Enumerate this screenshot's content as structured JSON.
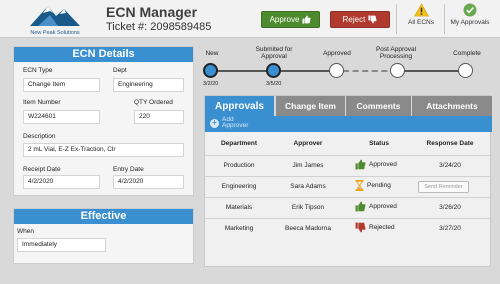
{
  "header": {
    "logo_text": "New Peak Solutions",
    "app_title": "ECN Manager",
    "ticket": "Ticket #: 2098589485",
    "approve_label": "Approve",
    "reject_label": "Reject",
    "nav_all": "All ECNs",
    "nav_my": "My Approvals"
  },
  "details": {
    "title": "ECN Details",
    "ecn_type_label": "ECN Type",
    "ecn_type_value": "Change Item",
    "dept_label": "Dept",
    "dept_value": "Engineering",
    "item_number_label": "Item Number",
    "item_number_value": "W224601",
    "qty_label": "QTY Ordered",
    "qty_value": "220",
    "description_label": "Description",
    "description_value": "2 mL Vial, E-Z Ex-Traction, Clr",
    "receipt_date_label": "Receipt Date",
    "receipt_date_value": "4/2/2020",
    "entry_date_label": "Entry Date",
    "entry_date_value": "4/2/2020"
  },
  "effective": {
    "title": "Effective",
    "when_label": "When",
    "when_value": "Immediately"
  },
  "progress": {
    "stages": [
      "New",
      "Submited for Approval",
      "Approved",
      "Post Approval Processing",
      "Complete"
    ],
    "dates": [
      "3/2/20",
      "3/5/20"
    ]
  },
  "tabs": [
    "Approvals",
    "Change Item",
    "Comments",
    "Attachments"
  ],
  "toolbar": {
    "add_approver": "Add Approver"
  },
  "table": {
    "headers": [
      "Department",
      "Approver",
      "Status",
      "Response Date"
    ],
    "rows": [
      {
        "department": "Production",
        "approver": "Jim James",
        "status": "Approved",
        "date": "3/24/20"
      },
      {
        "department": "Engineering",
        "approver": "Sara Adams",
        "status": "Pending",
        "action": "Send Reminder"
      },
      {
        "department": "Materials",
        "approver": "Erik Tipson",
        "status": "Approved",
        "date": "3/26/20"
      },
      {
        "department": "Marketing",
        "approver": "Beeca Madorna",
        "status": "Rejected",
        "date": "3/27/20"
      }
    ]
  },
  "colors": {
    "accent": "#3a8fd1",
    "approve": "#4e8a2e",
    "reject": "#b03a2e",
    "pending": "#e6a21a"
  }
}
